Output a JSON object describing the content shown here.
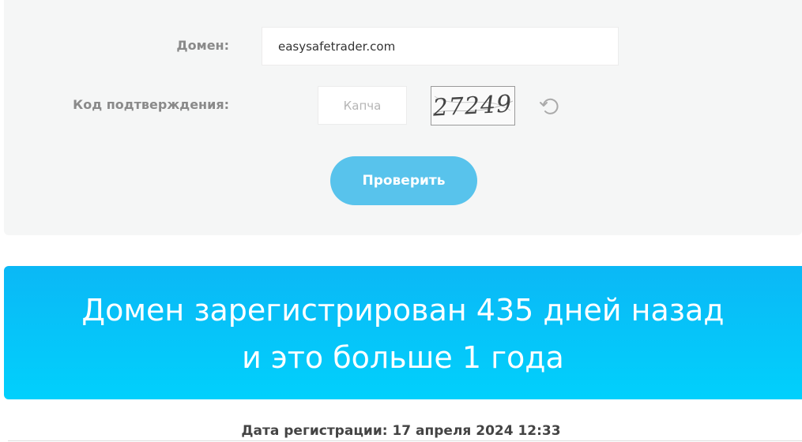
{
  "form": {
    "domain_label": "Домен:",
    "domain_value": "easysafetrader.com",
    "code_label": "Код подтверждения:",
    "captcha_placeholder": "Капча",
    "captcha_text": "27249",
    "check_button_label": "Проверить"
  },
  "result": {
    "line1": "Домен зарегистрирован 435 дней назад",
    "line2": "и это больше 1 года"
  },
  "registration": {
    "date_text": "Дата регистрации: 17 апреля 2024 12:33"
  },
  "icons": {
    "refresh": "refresh-icon"
  },
  "colors": {
    "button": "#58c3ec",
    "banner_top": "#0bb8f6",
    "banner_bottom": "#01d0fc",
    "panel": "#f5f6f6"
  }
}
